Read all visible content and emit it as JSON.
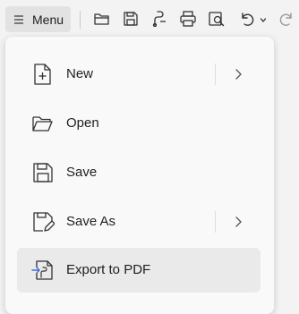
{
  "toolbar": {
    "menu_label": "Menu",
    "icons": [
      "open-folder-icon",
      "save-icon",
      "export-pdf-icon",
      "print-icon",
      "print-preview-icon",
      "undo-icon",
      "redo-icon"
    ]
  },
  "menu": {
    "items": [
      {
        "label": "New",
        "icon": "new-file-icon",
        "submenu": true
      },
      {
        "label": "Open",
        "icon": "open-folder-icon",
        "submenu": false
      },
      {
        "label": "Save",
        "icon": "save-icon",
        "submenu": false
      },
      {
        "label": "Save As",
        "icon": "save-as-icon",
        "submenu": true
      },
      {
        "label": "Export to PDF",
        "icon": "export-pdf-icon",
        "submenu": false,
        "highlighted": true
      }
    ]
  },
  "colors": {
    "background": "#f3f3f3",
    "panel": "#f9f9f9",
    "highlight": "#eaeaea",
    "menu_button": "#e2e2e2",
    "accent_arrow": "#3b6fd6",
    "icon_stroke": "#333333"
  }
}
